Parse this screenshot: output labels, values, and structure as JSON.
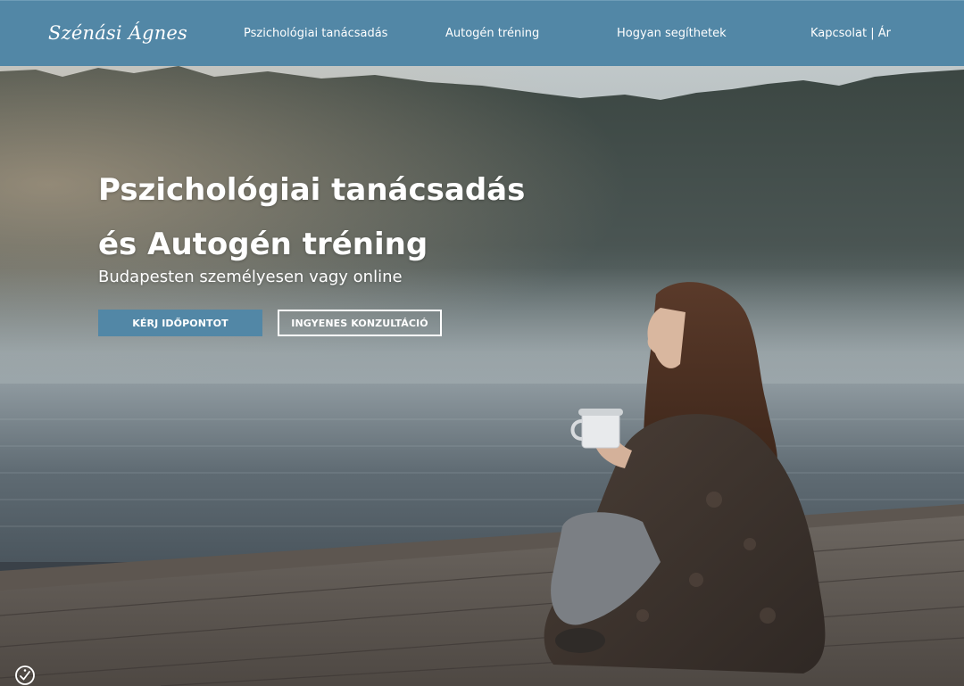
{
  "header": {
    "logo_text": "Szénási Ágnes",
    "nav": [
      {
        "label": "Pszichológiai tanácsadás"
      },
      {
        "label": "Autogén tréning"
      },
      {
        "label": "Hogyan segíthetek"
      },
      {
        "label": "Kapcsolat | Ár"
      }
    ]
  },
  "hero": {
    "title_line1": "Pszichológiai tanácsadás",
    "title_line2": "és Autogén tréning",
    "subtitle": "Budapesten személyesen vagy online",
    "primary_button": "KÉRJ IDŐPONTOT",
    "secondary_button": "INGYENES KONZULTÁCIÓ"
  },
  "widgets": {
    "accessibility_icon": "accessibility-icon"
  },
  "colors": {
    "brand_blue": "#5287a6",
    "text_white": "#ffffff"
  }
}
